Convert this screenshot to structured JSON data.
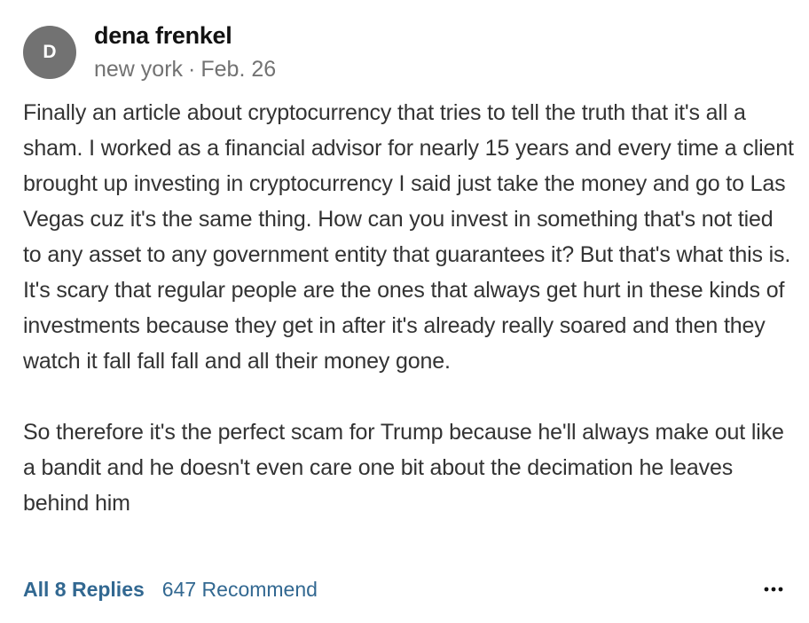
{
  "comment": {
    "avatar_initial": "D",
    "author": "dena frenkel",
    "location": "new york",
    "separator": "·",
    "date": "Feb. 26",
    "paragraphs": [
      "Finally an article about cryptocurrency that tries to tell the truth that it's all a sham. I worked as a financial advisor for nearly 15 years and every time a client brought up investing in cryptocurrency I said just take the money and go to Las Vegas cuz it's the same thing. How can you invest in something that's not tied to any asset to any government entity that guarantees it? But that's what this is. It's scary that regular people are the ones that always get hurt in these kinds of investments because they get in after it's already really soared and then they watch it fall fall fall and all their money gone.",
      "So therefore it's the perfect scam for Trump because he'll always make out like a bandit and he doesn't even care one bit about the decimation he leaves behind him"
    ],
    "replies_label": "All 8 Replies",
    "recommend_label": "647 Recommend",
    "more_icon": "more-horizontal-icon"
  },
  "colors": {
    "avatar_bg": "#727272",
    "link": "#326891",
    "meta": "#727272",
    "body_text": "#333333"
  }
}
